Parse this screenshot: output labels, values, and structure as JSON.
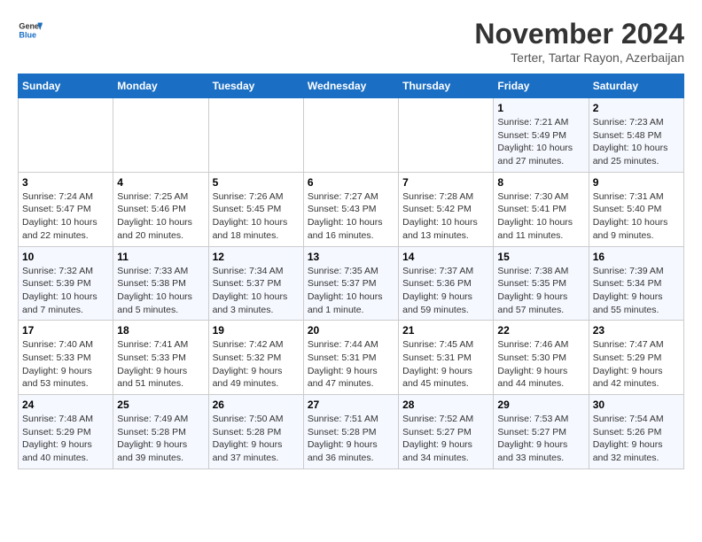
{
  "header": {
    "logo_line1": "General",
    "logo_line2": "Blue",
    "month_title": "November 2024",
    "location": "Terter, Tartar Rayon, Azerbaijan"
  },
  "weekdays": [
    "Sunday",
    "Monday",
    "Tuesday",
    "Wednesday",
    "Thursday",
    "Friday",
    "Saturday"
  ],
  "weeks": [
    [
      {
        "day": "",
        "info": ""
      },
      {
        "day": "",
        "info": ""
      },
      {
        "day": "",
        "info": ""
      },
      {
        "day": "",
        "info": ""
      },
      {
        "day": "",
        "info": ""
      },
      {
        "day": "1",
        "info": "Sunrise: 7:21 AM\nSunset: 5:49 PM\nDaylight: 10 hours and 27 minutes."
      },
      {
        "day": "2",
        "info": "Sunrise: 7:23 AM\nSunset: 5:48 PM\nDaylight: 10 hours and 25 minutes."
      }
    ],
    [
      {
        "day": "3",
        "info": "Sunrise: 7:24 AM\nSunset: 5:47 PM\nDaylight: 10 hours and 22 minutes."
      },
      {
        "day": "4",
        "info": "Sunrise: 7:25 AM\nSunset: 5:46 PM\nDaylight: 10 hours and 20 minutes."
      },
      {
        "day": "5",
        "info": "Sunrise: 7:26 AM\nSunset: 5:45 PM\nDaylight: 10 hours and 18 minutes."
      },
      {
        "day": "6",
        "info": "Sunrise: 7:27 AM\nSunset: 5:43 PM\nDaylight: 10 hours and 16 minutes."
      },
      {
        "day": "7",
        "info": "Sunrise: 7:28 AM\nSunset: 5:42 PM\nDaylight: 10 hours and 13 minutes."
      },
      {
        "day": "8",
        "info": "Sunrise: 7:30 AM\nSunset: 5:41 PM\nDaylight: 10 hours and 11 minutes."
      },
      {
        "day": "9",
        "info": "Sunrise: 7:31 AM\nSunset: 5:40 PM\nDaylight: 10 hours and 9 minutes."
      }
    ],
    [
      {
        "day": "10",
        "info": "Sunrise: 7:32 AM\nSunset: 5:39 PM\nDaylight: 10 hours and 7 minutes."
      },
      {
        "day": "11",
        "info": "Sunrise: 7:33 AM\nSunset: 5:38 PM\nDaylight: 10 hours and 5 minutes."
      },
      {
        "day": "12",
        "info": "Sunrise: 7:34 AM\nSunset: 5:37 PM\nDaylight: 10 hours and 3 minutes."
      },
      {
        "day": "13",
        "info": "Sunrise: 7:35 AM\nSunset: 5:37 PM\nDaylight: 10 hours and 1 minute."
      },
      {
        "day": "14",
        "info": "Sunrise: 7:37 AM\nSunset: 5:36 PM\nDaylight: 9 hours and 59 minutes."
      },
      {
        "day": "15",
        "info": "Sunrise: 7:38 AM\nSunset: 5:35 PM\nDaylight: 9 hours and 57 minutes."
      },
      {
        "day": "16",
        "info": "Sunrise: 7:39 AM\nSunset: 5:34 PM\nDaylight: 9 hours and 55 minutes."
      }
    ],
    [
      {
        "day": "17",
        "info": "Sunrise: 7:40 AM\nSunset: 5:33 PM\nDaylight: 9 hours and 53 minutes."
      },
      {
        "day": "18",
        "info": "Sunrise: 7:41 AM\nSunset: 5:33 PM\nDaylight: 9 hours and 51 minutes."
      },
      {
        "day": "19",
        "info": "Sunrise: 7:42 AM\nSunset: 5:32 PM\nDaylight: 9 hours and 49 minutes."
      },
      {
        "day": "20",
        "info": "Sunrise: 7:44 AM\nSunset: 5:31 PM\nDaylight: 9 hours and 47 minutes."
      },
      {
        "day": "21",
        "info": "Sunrise: 7:45 AM\nSunset: 5:31 PM\nDaylight: 9 hours and 45 minutes."
      },
      {
        "day": "22",
        "info": "Sunrise: 7:46 AM\nSunset: 5:30 PM\nDaylight: 9 hours and 44 minutes."
      },
      {
        "day": "23",
        "info": "Sunrise: 7:47 AM\nSunset: 5:29 PM\nDaylight: 9 hours and 42 minutes."
      }
    ],
    [
      {
        "day": "24",
        "info": "Sunrise: 7:48 AM\nSunset: 5:29 PM\nDaylight: 9 hours and 40 minutes."
      },
      {
        "day": "25",
        "info": "Sunrise: 7:49 AM\nSunset: 5:28 PM\nDaylight: 9 hours and 39 minutes."
      },
      {
        "day": "26",
        "info": "Sunrise: 7:50 AM\nSunset: 5:28 PM\nDaylight: 9 hours and 37 minutes."
      },
      {
        "day": "27",
        "info": "Sunrise: 7:51 AM\nSunset: 5:28 PM\nDaylight: 9 hours and 36 minutes."
      },
      {
        "day": "28",
        "info": "Sunrise: 7:52 AM\nSunset: 5:27 PM\nDaylight: 9 hours and 34 minutes."
      },
      {
        "day": "29",
        "info": "Sunrise: 7:53 AM\nSunset: 5:27 PM\nDaylight: 9 hours and 33 minutes."
      },
      {
        "day": "30",
        "info": "Sunrise: 7:54 AM\nSunset: 5:26 PM\nDaylight: 9 hours and 32 minutes."
      }
    ]
  ]
}
